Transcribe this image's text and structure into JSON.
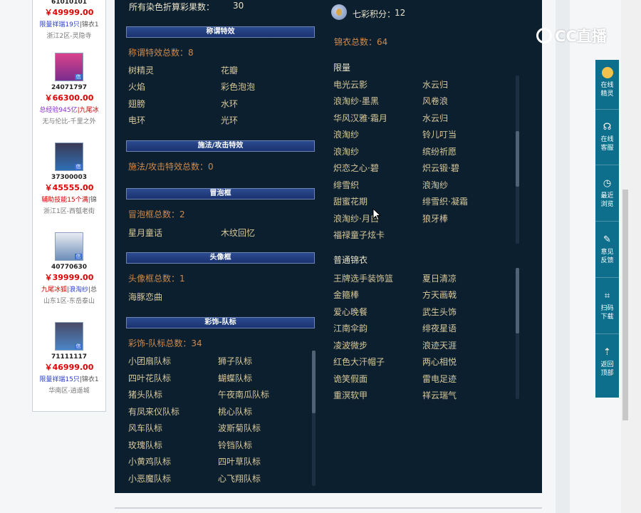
{
  "left_list": [
    {
      "id": "61010101",
      "price": "￥49999.00",
      "tags": [
        "限量祥瑞19只",
        "|锦衣1"
      ],
      "tag_colors": [
        "#2a3fc9",
        "#555555"
      ],
      "server": "浙江2区-灵隐寺"
    },
    {
      "id": "24071797",
      "price": "￥66300.00",
      "tags": [
        "总经验945亿",
        "|九尾冰"
      ],
      "tag_colors": [
        "#8a2bd1",
        "#d10000"
      ],
      "server": "无与伦比-千里之外"
    },
    {
      "id": "37300003",
      "price": "￥45555.00",
      "tags": [
        "辅助技能15个满",
        "|锦"
      ],
      "tag_colors": [
        "#d10000",
        "#555555"
      ],
      "server": "浙江1区-西瓠老街"
    },
    {
      "id": "40770630",
      "price": "￥39999.00",
      "tags": [
        "九尾冰狐",
        "|浪淘纱",
        "|总"
      ],
      "tag_colors": [
        "#d10000",
        "#2a3fc9",
        "#555555"
      ],
      "server": "山东1区-东岳泰山"
    },
    {
      "id": "71111117",
      "price": "￥46999.00",
      "tags": [
        "限量祥瑞15只",
        "|锦衣1"
      ],
      "tag_colors": [
        "#2a3fc9",
        "#555555"
      ],
      "server": "华南区-逍遥城"
    }
  ],
  "panel": {
    "dye_label": "所有染色折算彩果数：",
    "dye_value": "30",
    "qicai_label": "七彩积分：",
    "qicai_value": "12",
    "title_effects": {
      "head": "称谓特效",
      "count": "称谓特效总数：8",
      "items": [
        "树精灵",
        "花瓣",
        "火焰",
        "彩色泡泡",
        "翅膀",
        "水环",
        "电环",
        "光环"
      ]
    },
    "spell_effects": {
      "head": "施法/攻击特效",
      "count": "施法/攻击特效总数：0"
    },
    "bubble": {
      "head": "冒泡框",
      "count": "冒泡框总数：2",
      "items": [
        "星月童话",
        "木纹回忆"
      ]
    },
    "avatar_frame": {
      "head": "头像框",
      "count": "头像框总数：1",
      "items": [
        "海豚恋曲"
      ]
    },
    "team_badge": {
      "head": "彩饰-队标",
      "count": "彩饰-队标总数：34",
      "items": [
        "小团扇队标",
        "狮子队标",
        "四叶花队标",
        "蝴蝶队标",
        "猪头队标",
        "午夜南瓜队标",
        "有凤来仪队标",
        "桃心队标",
        "风车队标",
        "波斯菊队标",
        "玫瑰队标",
        "铃铛队标",
        "小黄鸡队标",
        "四叶草队标",
        "小恶魔队标",
        "心飞翔队标"
      ]
    },
    "outfits": {
      "count": "锦衣总数：64",
      "limited_head": "限量",
      "limited": [
        "电光云影",
        "水云归",
        "浪淘纱·墨黑",
        "风卷浪",
        "华风汉雅·霜月",
        "水云归",
        "浪淘纱",
        "铃儿叮当",
        "浪淘纱",
        "缤纷祈愿",
        "炽恋之心·碧",
        "炽云锻·碧",
        "绯雪织",
        "浪淘纱",
        "甜蜜花期",
        "绯雪织·凝霜",
        "浪淘纱·月白",
        "狼牙棒",
        "福禄童子炫卡"
      ],
      "normal_head": "普通锦衣",
      "normal": [
        "王牌选手装饰篮",
        "夏日清凉",
        "金箍棒",
        "方天画戟",
        "爱心晚餐",
        "武生头饰",
        "江南伞韵",
        "绯夜星语",
        "凌波微步",
        "浪迹天涯",
        "红色大汗帽子",
        "两心相悦",
        "诡笑假面",
        "雷电足迹",
        "重溟软甲",
        "祥云瑞气"
      ]
    }
  },
  "logo": {
    "text": "CC直播"
  },
  "toolbar": [
    {
      "icon": "sprite-icon",
      "label1": "在线",
      "label2": "精灵"
    },
    {
      "icon": "headset-icon",
      "label1": "在线",
      "label2": "客服"
    },
    {
      "icon": "clock-icon",
      "label1": "最近",
      "label2": "浏览"
    },
    {
      "icon": "feedback-icon",
      "label1": "意见",
      "label2": "反馈"
    },
    {
      "icon": "scan-icon",
      "label1": "扫码",
      "label2": "下载"
    },
    {
      "icon": "arrow-up-icon",
      "label1": "返回",
      "label2": "顶部"
    }
  ]
}
